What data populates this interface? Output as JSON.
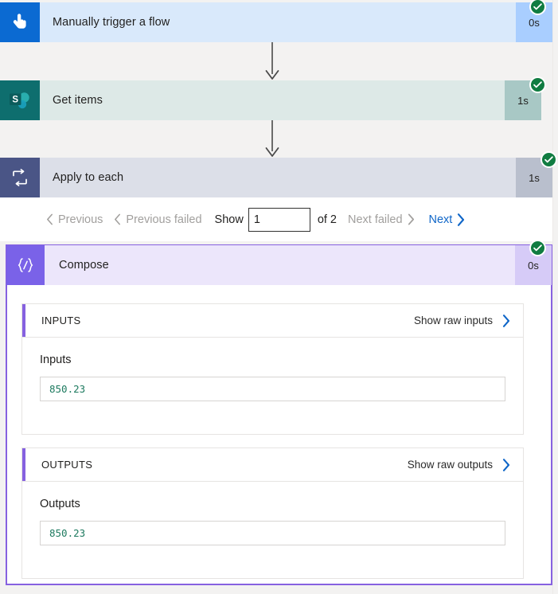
{
  "flow": {
    "steps": [
      {
        "name": "Manually trigger a flow",
        "duration": "0s",
        "status": "succeeded",
        "icon": "hand-tap-icon",
        "accent": "#0b6ad2",
        "body_bg": "#d9e9fb",
        "duration_bg": "#a9ceff"
      },
      {
        "name": "Get items",
        "duration": "1s",
        "status": "succeeded",
        "icon": "sharepoint-icon",
        "accent": "#0e6e6e",
        "body_bg": "#dde9e7",
        "duration_bg": "#a8c8c5"
      },
      {
        "name": "Apply to each",
        "duration": "1s",
        "status": "succeeded",
        "icon": "loop-icon",
        "accent": "#4a5586",
        "body_bg": "#dcdfe8",
        "duration_bg": "#b9bfcd"
      },
      {
        "name": "Compose",
        "duration": "0s",
        "status": "succeeded",
        "icon": "compose-braces-icon",
        "accent": "#7a62e8",
        "body_bg": "#ece6fb",
        "duration_bg": "#d6cbf7"
      }
    ]
  },
  "pagination": {
    "previous_label": "Previous",
    "previous_failed_label": "Previous failed",
    "show_label": "Show",
    "page_value": "1",
    "of_total_label": "of 2",
    "next_failed_label": "Next failed",
    "next_label": "Next",
    "previous_enabled": false,
    "previous_failed_enabled": false,
    "next_failed_enabled": false,
    "next_enabled": true,
    "disabled_color": "#a19f9d",
    "enabled_color": "#0f66c8"
  },
  "compose": {
    "inputs": {
      "section_title": "INPUTS",
      "raw_link_label": "Show raw inputs",
      "field_label": "Inputs",
      "value": "850.23"
    },
    "outputs": {
      "section_title": "OUTPUTS",
      "raw_link_label": "Show raw outputs",
      "field_label": "Outputs",
      "value": "850.23"
    }
  },
  "theme": {
    "success_green": "#107c41",
    "link_blue": "#0f66c8",
    "compose_purple": "#8661e0",
    "page_bg": "#f3f2f1"
  }
}
